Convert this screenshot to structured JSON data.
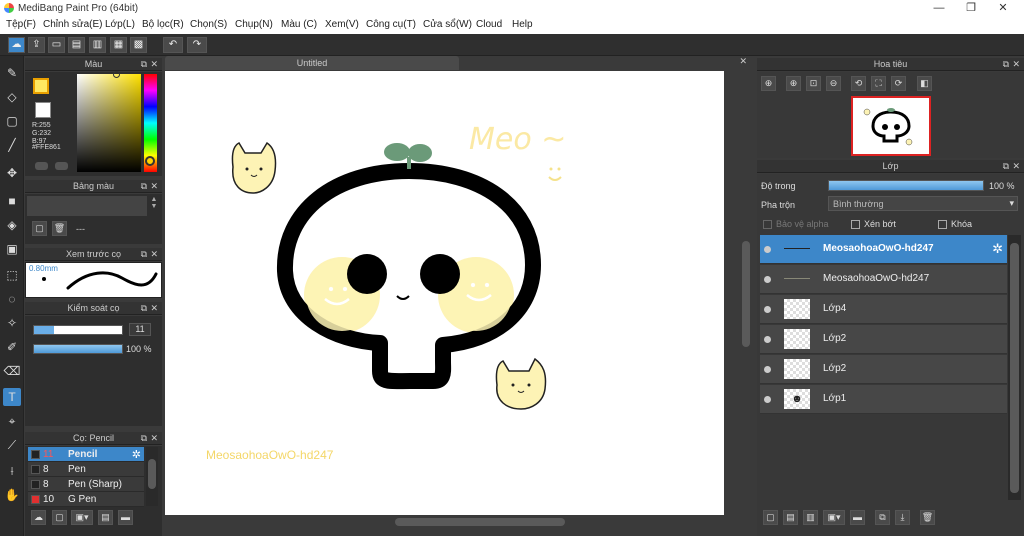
{
  "app": {
    "title": "MediBang Paint Pro (64bit)"
  },
  "window_controls": {
    "minimize": "—",
    "maximize": "❐",
    "close": "✕"
  },
  "menu": [
    "Tệp(F)",
    "Chỉnh sửa(E)",
    "Lớp(L)",
    "Bộ lọc(R)",
    "Chọn(S)",
    "Chụp(N)",
    "Màu (C)",
    "Xem(V)",
    "Công cụ(T)",
    "Cửa sổ(W)",
    "Cloud",
    "Help"
  ],
  "toolbar": {
    "undo_icon": "undo-icon",
    "redo_icon": "redo-icon"
  },
  "color_panel": {
    "title": "Màu",
    "r": "R:255",
    "g": "G:232",
    "b": "B:97",
    "hex": "#FFE861",
    "primary_color": "#FFE861"
  },
  "palette_panel": {
    "title": "Bảng màu",
    "value": "---"
  },
  "preview_panel": {
    "title": "Xem trước cọ",
    "size": "0.80mm"
  },
  "brush_control_panel": {
    "title": "Kiểm soát cọ",
    "size": "11",
    "opacity": "100 %",
    "opacity_fraction": 1.0
  },
  "brush_panel": {
    "title": "Cọ: Pencil",
    "brushes": [
      {
        "size": "11",
        "name": "Pencil",
        "color": "#222222"
      },
      {
        "size": "8",
        "name": "Pen",
        "color": "#222222"
      },
      {
        "size": "8",
        "name": "Pen (Sharp)",
        "color": "#222222"
      },
      {
        "size": "10",
        "name": "G Pen",
        "color": "#e03030"
      }
    ]
  },
  "canvas": {
    "tab": "Untitled",
    "text_meo": "Meo ~",
    "watermark": "MeosaohoaOwO-hd247"
  },
  "navigator_panel": {
    "title": "Hoa tiêu"
  },
  "layer_panel": {
    "title": "Lớp",
    "opacity_label": "Độ trong",
    "opacity_value": "100 %",
    "opacity_fraction": 1.0,
    "blend_label": "Pha trộn",
    "blend_value": "Bình thường",
    "protect_alpha": "Bảo vệ alpha",
    "clipping": "Xén bớt",
    "lock": "Khóa",
    "layers": [
      {
        "name": "MeosaohoaOwO-hd247",
        "selected": true
      },
      {
        "name": "MeosaohoaOwO-hd247",
        "selected": false
      },
      {
        "name": "Lớp4",
        "selected": false
      },
      {
        "name": "Lớp2",
        "selected": false
      },
      {
        "name": "Lớp2",
        "selected": false
      },
      {
        "name": "Lớp1",
        "selected": false
      }
    ]
  },
  "colors": {
    "accent": "#3d87c9",
    "panel_bg": "#2e2e2e",
    "pastel_yellow": "#fdf3b5"
  }
}
